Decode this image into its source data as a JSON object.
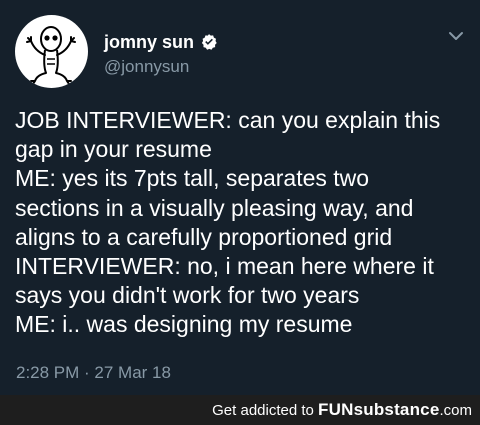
{
  "tweet": {
    "display_name": "jomny sun",
    "handle": "@jonnysun",
    "avatar_icon": "alien-doodle-avatar",
    "verified_icon": "verified-badge-icon",
    "menu_icon": "chevron-down-icon",
    "body_lines": [
      "JOB INTERVIEWER: can you explain this",
      "gap in your resume",
      "ME: yes its 7pts tall, separates two",
      "sections in a visually pleasing way, and",
      "aligns to a carefully proportioned grid",
      "INTERVIEWER: no, i mean here where it",
      "says you didn't work for two years",
      "ME: i.. was designing my resume"
    ],
    "timestamp": "2:28 PM · 27 Mar 18"
  },
  "footer": {
    "prefix": "Get addicted to",
    "brand": "FUNsubstance",
    "suffix": ".com"
  },
  "colors": {
    "background": "#15202b",
    "text_primary": "#ffffff",
    "text_secondary": "#8899a6",
    "footer_bg": "#1e1e1e"
  }
}
